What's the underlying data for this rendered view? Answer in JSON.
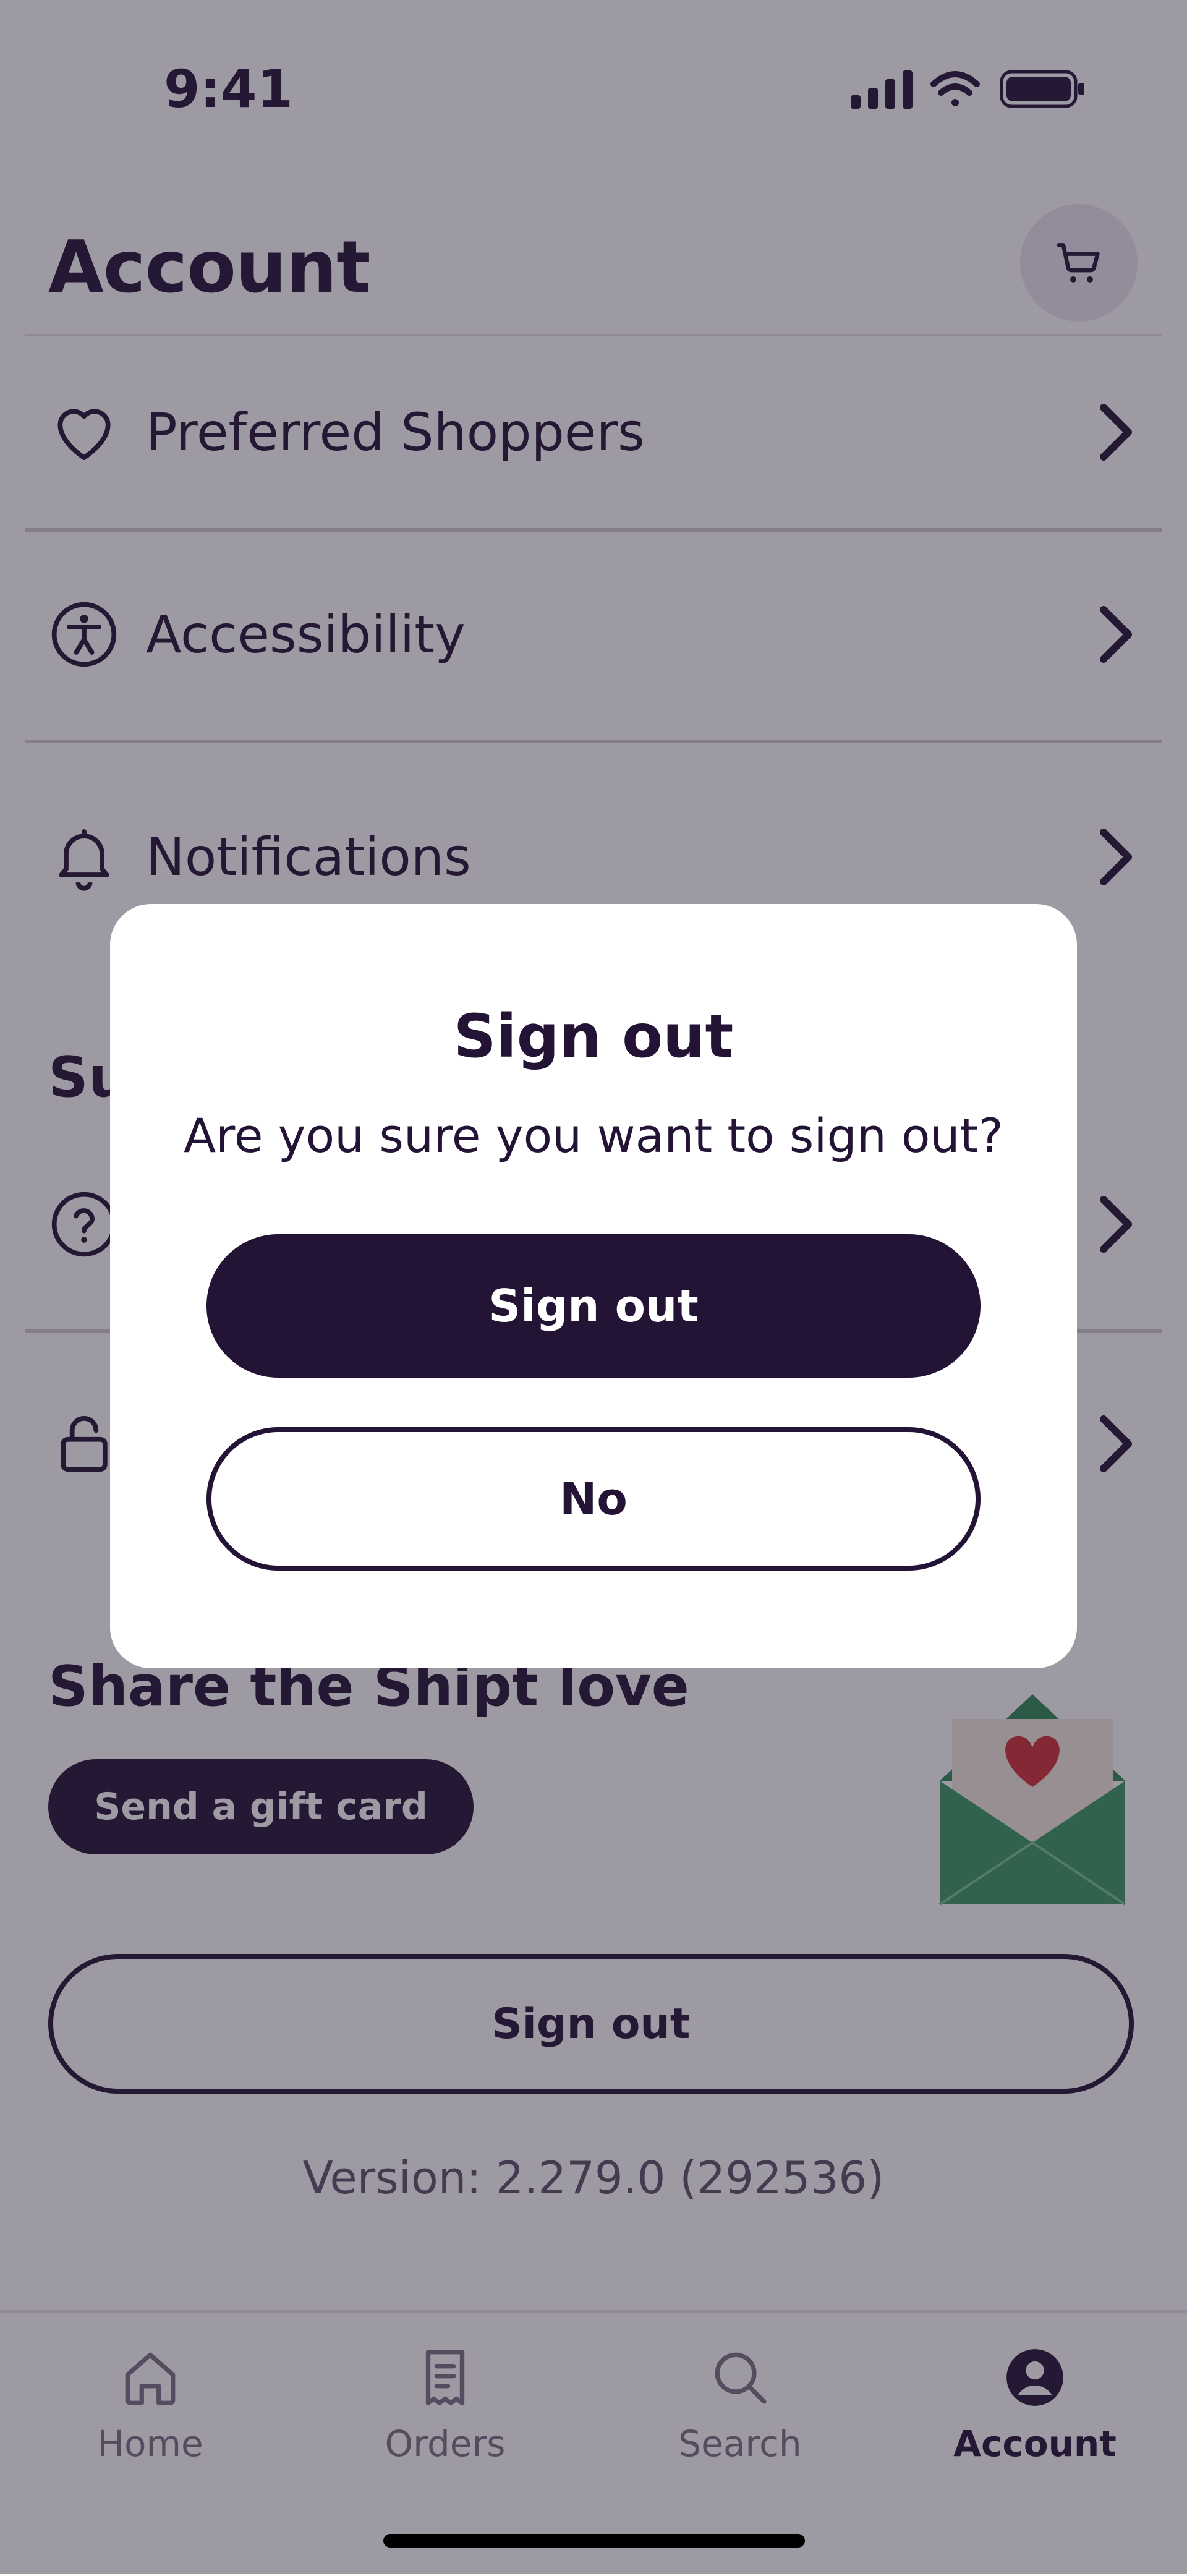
{
  "status_bar": {
    "time": "9:41"
  },
  "header": {
    "title": "Account",
    "cart_icon": "cart-icon"
  },
  "menu_items": [
    {
      "label": "Preferred Shoppers",
      "icon": "heart-icon"
    },
    {
      "label": "Accessibility",
      "icon": "accessibility-icon"
    },
    {
      "label": "Notifications",
      "icon": "bell-icon"
    }
  ],
  "support": {
    "title_visible": "Su"
  },
  "hidden_rows": [
    {
      "icon": "help-icon"
    },
    {
      "icon": "lock-icon"
    }
  ],
  "share": {
    "title": "Share the Shipt love",
    "gift_button": "Send a gift card"
  },
  "sign_out_button": "Sign out",
  "version": "Version: 2.279.0 (292536)",
  "tabbar": {
    "items": [
      {
        "label": "Home",
        "icon": "home-icon",
        "active": false
      },
      {
        "label": "Orders",
        "icon": "orders-icon",
        "active": false
      },
      {
        "label": "Search",
        "icon": "search-icon",
        "active": false
      },
      {
        "label": "Account",
        "icon": "account-icon",
        "active": true
      }
    ]
  },
  "dialog": {
    "title": "Sign out",
    "message": "Are you sure you want to sign out?",
    "confirm_label": "Sign out",
    "cancel_label": "No"
  },
  "colors": {
    "brand": "#231335",
    "scrim": "#282034",
    "envelope_green": "#3a9a63",
    "heart_red": "#d2303a"
  }
}
